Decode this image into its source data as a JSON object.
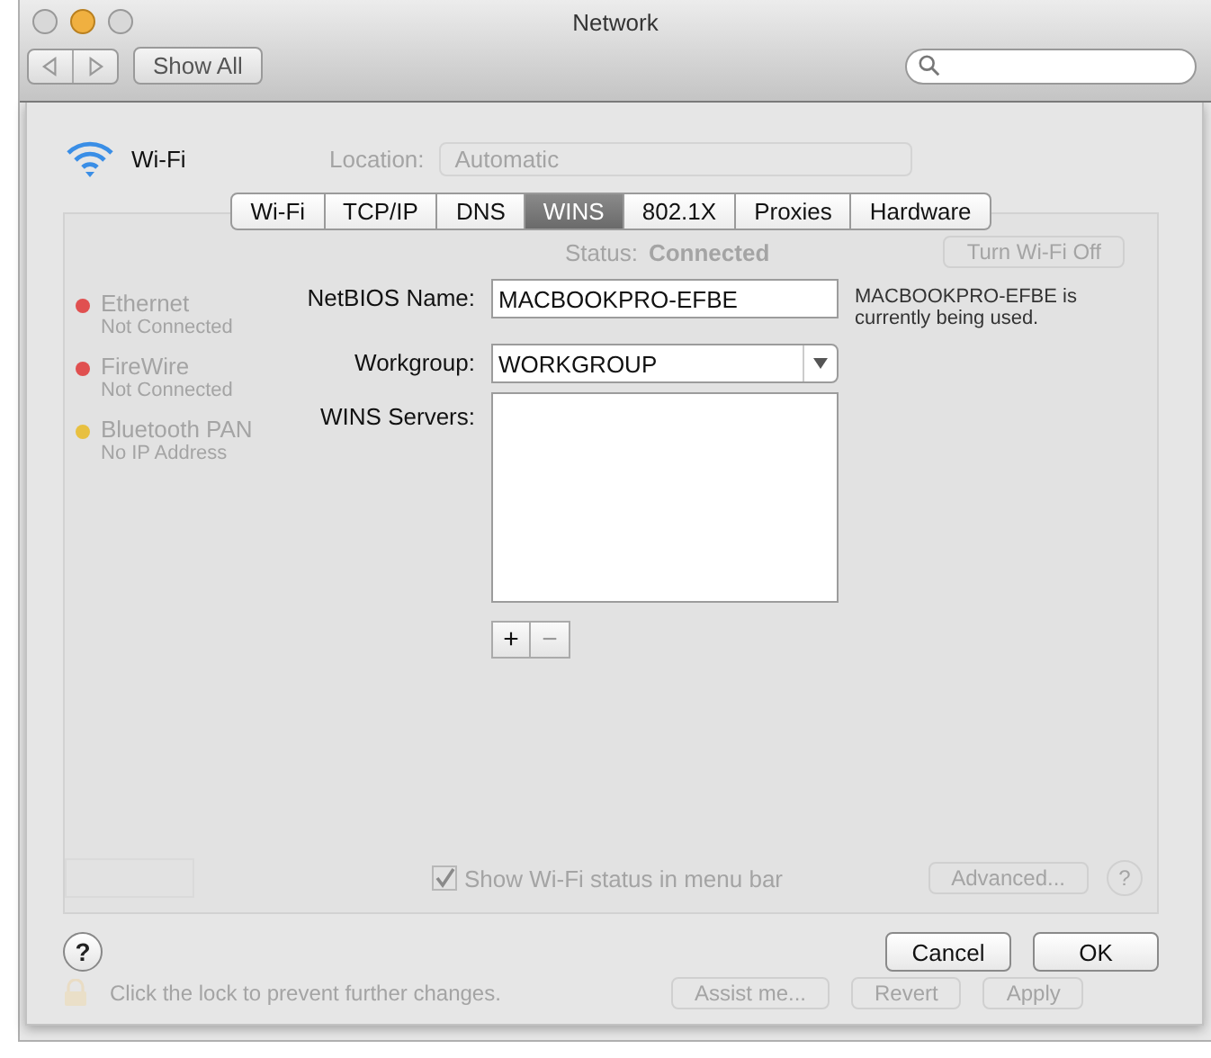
{
  "window": {
    "title": "Network",
    "show_all": "Show All"
  },
  "background": {
    "location_label": "Location:",
    "location_value": "Automatic",
    "services": [
      {
        "name": "Ethernet",
        "status": "Not Connected",
        "color": "#e05050"
      },
      {
        "name": "FireWire",
        "status": "Not Connected",
        "color": "#e05050"
      },
      {
        "name": "Bluetooth PAN",
        "status": "No IP Address",
        "color": "#e8c040"
      }
    ],
    "status_label": "Status:",
    "status_value": "Connected",
    "turn_off": "Turn Wi-Fi Off",
    "show_status": {
      "label": "Show Wi-Fi status in menu bar",
      "checked": true
    },
    "advanced": "Advanced...",
    "help": "?",
    "lock_text": "Click the lock to prevent further changes.",
    "assist": "Assist me...",
    "revert": "Revert",
    "apply": "Apply"
  },
  "sheet": {
    "service": "Wi-Fi",
    "tabs": [
      {
        "label": "Wi-Fi",
        "selected": false
      },
      {
        "label": "TCP/IP",
        "selected": false
      },
      {
        "label": "DNS",
        "selected": false
      },
      {
        "label": "WINS",
        "selected": true
      },
      {
        "label": "802.1X",
        "selected": false
      },
      {
        "label": "Proxies",
        "selected": false
      },
      {
        "label": "Hardware",
        "selected": false
      }
    ],
    "netbios_label": "NetBIOS Name:",
    "netbios_value": "MACBOOKPRO-EFBE",
    "note": "MACBOOKPRO-EFBE is currently being used.",
    "workgroup_label": "Workgroup:",
    "workgroup_value": "WORKGROUP",
    "wins_label": "WINS Servers:",
    "wins_buttons": [
      {
        "label": "+",
        "disabled": false
      },
      {
        "label": "−",
        "disabled": true
      }
    ],
    "help": "?",
    "cancel": "Cancel",
    "ok": "OK"
  }
}
